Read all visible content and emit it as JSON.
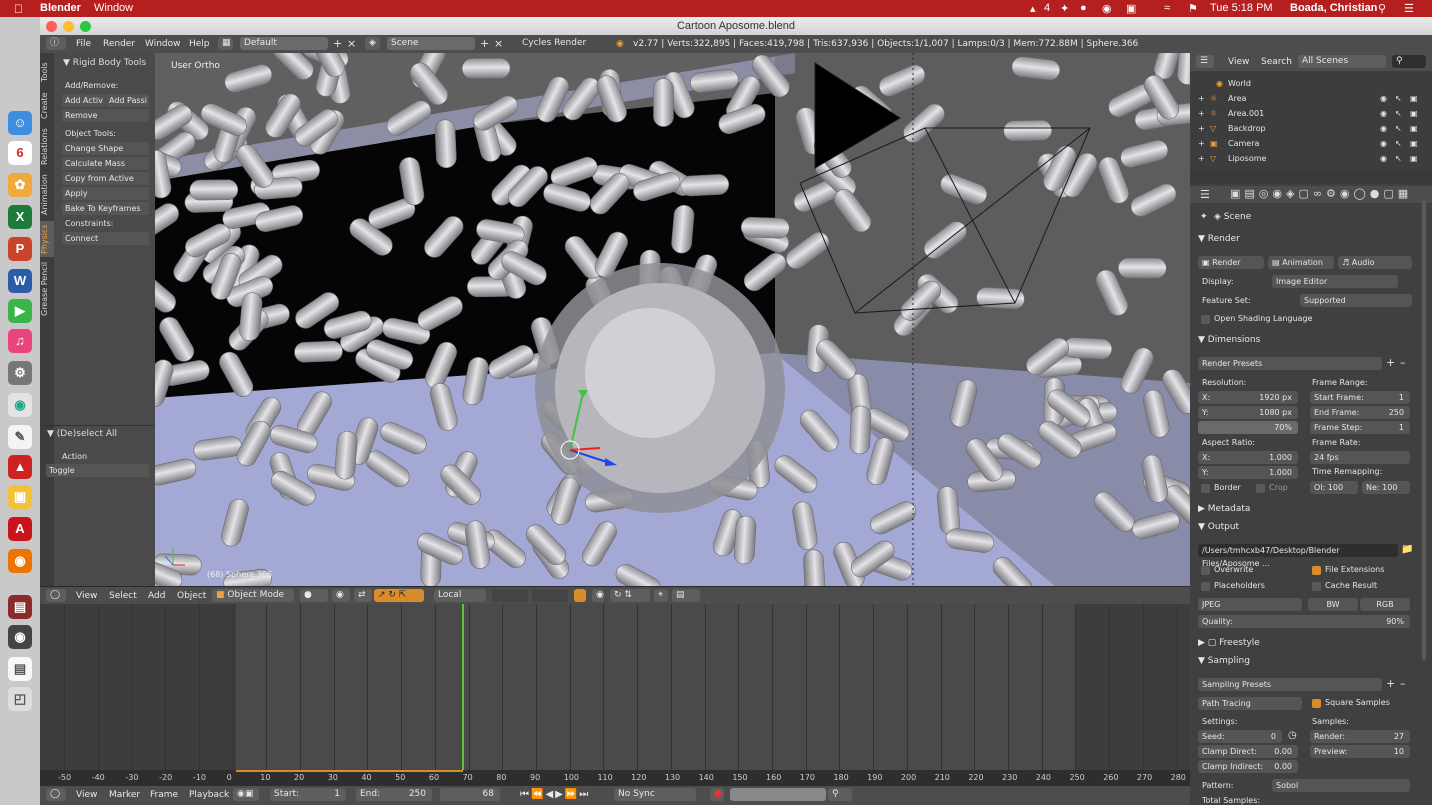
{
  "mac_menu": {
    "app": "Blender",
    "window": "Window",
    "battery_num": "4",
    "time": "Tue 5:18 PM",
    "user": "Boada, Christian"
  },
  "window_title": "Cartoon Aposome.blend",
  "header": {
    "menu_file": "File",
    "menu_render": "Render",
    "menu_window": "Window",
    "menu_help": "Help",
    "layout": "Default",
    "scene": "Scene",
    "engine": "Cycles Render",
    "stats": "v2.77 | Verts:322,895 | Faces:419,798 | Tris:637,936 | Objects:1/1,007 | Lamps:0/3 | Mem:772.88M | Sphere.366"
  },
  "tool_tabs": [
    "Tools",
    "Create",
    "Relations",
    "Animation",
    "Physics",
    "Grease Pencil"
  ],
  "toolshelf": {
    "panel_title": "Rigid Body Tools",
    "add_remove": "Add/Remove:",
    "add_active": "Add Activ",
    "add_passive": "Add Passi",
    "remove": "Remove",
    "object_tools": "Object Tools:",
    "change_shape": "Change Shape",
    "calc_mass": "Calculate Mass",
    "copy_active": "Copy from Active",
    "apply_transform": "Apply Transformation",
    "bake": "Bake To Keyframes",
    "constraints": "Constraints:",
    "connect": "Connect",
    "op_title": "(De)select All",
    "action_label": "Action",
    "action_value": "Toggle"
  },
  "viewport": {
    "view_label": "User Ortho",
    "object_label": "(68) Sphere.366"
  },
  "v3d_header": {
    "view": "View",
    "select": "Select",
    "add": "Add",
    "object": "Object",
    "mode": "Object Mode",
    "orientation": "Local"
  },
  "timeline": {
    "ticks": [
      "-50",
      "-40",
      "-30",
      "-20",
      "-10",
      "0",
      "10",
      "20",
      "30",
      "40",
      "50",
      "60",
      "70",
      "80",
      "90",
      "100",
      "110",
      "120",
      "130",
      "140",
      "150",
      "160",
      "170",
      "180",
      "190",
      "200",
      "210",
      "220",
      "230",
      "240",
      "250",
      "260",
      "270",
      "280"
    ],
    "current_frame": 68,
    "footer_view": "View",
    "footer_marker": "Marker",
    "footer_frame": "Frame",
    "footer_playback": "Playback",
    "start_label": "Start:",
    "start_value": "1",
    "end_label": "End:",
    "end_value": "250",
    "frame_value": "68",
    "sync": "No Sync"
  },
  "outliner": {
    "view": "View",
    "search": "Search",
    "filter": "All Scenes",
    "items": [
      "World",
      "Area",
      "Area.001",
      "Backdrop",
      "Camera",
      "Liposome"
    ]
  },
  "properties": {
    "scene": "Scene",
    "render_section": "Render",
    "render_btn": "Render",
    "animation_btn": "Animation",
    "audio_btn": "Audio",
    "display_label": "Display:",
    "display_value": "Image Editor",
    "feature_label": "Feature Set:",
    "feature_value": "Supported",
    "osl": "Open Shading Language",
    "dimensions": "Dimensions",
    "render_presets": "Render Presets",
    "resolution": "Resolution:",
    "res_x_label": "X:",
    "res_x": "1920 px",
    "res_y_label": "Y:",
    "res_y": "1080 px",
    "res_pct": "70%",
    "frame_range": "Frame Range:",
    "start_frame_label": "Start Frame:",
    "start_frame": "1",
    "end_frame_label": "End Frame:",
    "end_frame": "250",
    "frame_step_label": "Frame Step:",
    "frame_step": "1",
    "aspect": "Aspect Ratio:",
    "asp_x_label": "X:",
    "asp_x": "1.000",
    "asp_y_label": "Y:",
    "asp_y": "1.000",
    "frame_rate": "Frame Rate:",
    "fps": "24 fps",
    "time_remap": "Time Remapping:",
    "old": "Ol: 100",
    "new": "Ne: 100",
    "border": "Border",
    "crop": "Crop",
    "metadata": "Metadata",
    "output": "Output",
    "output_path": "/Users/tmhcxb47/Desktop/Blender Files/Aposome ...",
    "overwrite": "Overwrite",
    "file_ext": "File Extensions",
    "placeholders": "Placeholders",
    "cache_result": "Cache Result",
    "format": "JPEG",
    "bw": "BW",
    "rgb": "RGB",
    "quality_label": "Quality:",
    "quality": "90%",
    "freestyle": "Freestyle",
    "sampling": "Sampling",
    "sampling_presets": "Sampling Presets",
    "integrator": "Path Tracing",
    "square_samples": "Square Samples",
    "settings": "Settings:",
    "seed_label": "Seed:",
    "seed": "0",
    "clamp_direct_label": "Clamp Direct:",
    "clamp_direct": "0.00",
    "clamp_indirect_label": "Clamp Indirect:",
    "clamp_indirect": "0.00",
    "samples": "Samples:",
    "render_samples_label": "Render:",
    "render_samples": "27",
    "preview_samples_label": "Preview:",
    "preview_samples": "10",
    "pattern_label": "Pattern:",
    "pattern": "Sobol",
    "total_samples": "Total Samples:"
  },
  "colors": {
    "mac_bar": "#b61f1f",
    "accent_orange": "#d98c2b",
    "timeline_cursor": "#5ec23a",
    "capsule": "#c8c8cc",
    "floor": "#a8acd8"
  }
}
